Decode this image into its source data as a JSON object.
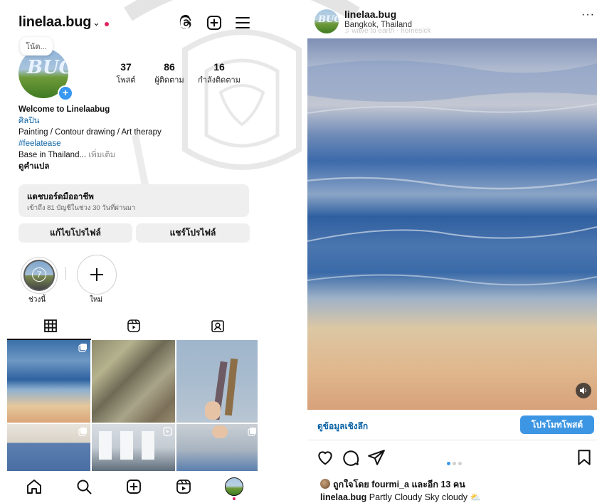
{
  "left": {
    "username": "linelaa.bug",
    "note": "โน้ต...",
    "avatar_text": "BUG",
    "stats": [
      {
        "value": "37",
        "label": "โพสต์"
      },
      {
        "value": "86",
        "label": "ผู้ติดตาม"
      },
      {
        "value": "16",
        "label": "กำลังติดตาม"
      }
    ],
    "bio": {
      "name": "Welcome to Linelaabug",
      "category": "ศิลปิน",
      "line1": "Painting / Contour drawing / Art therapy",
      "hashtag": "#feelatease",
      "line3": "Base in Thailand...",
      "more": "เพิ่มเติม",
      "translate": "ดูคำแปล"
    },
    "dashboard": {
      "title": "แดชบอร์ดมืออาชีพ",
      "subtitle": "เข้าถึง 81 บัญชีในช่วง 30 วันที่ผ่านมา"
    },
    "buttons": {
      "edit": "แก้ไขโปรไฟล์",
      "share": "แชร์โปรไฟล์"
    },
    "highlights": [
      {
        "label": "ช่วงนี้",
        "badge": "7"
      },
      {
        "label": "ใหม่"
      }
    ]
  },
  "right": {
    "username": "linelaa.bug",
    "location": "Bangkok, Thailand",
    "music": "♫ wave to earth · homesick",
    "insights_link": "ดูข้อมูลเชิงลึก",
    "promote_button": "โปรโมทโพสต์",
    "carousel": {
      "current": 1,
      "total": 3
    },
    "liked_by_prefix": "ถูกใจโดย ",
    "liked_by_user": "fourmi_a",
    "liked_by_suffix": " และอีก 13 คน",
    "caption_user": "linelaa.bug",
    "caption_text": " Partly Cloudy Sky cloudy ⛅"
  },
  "colors": {
    "accent": "#3897f0",
    "link": "#0b63a6",
    "notification": "#e0245e"
  },
  "icons": [
    "threads-icon",
    "new-post-icon",
    "menu-icon",
    "grid-icon",
    "reels-icon",
    "tagged-icon",
    "home-icon",
    "search-icon",
    "create-icon",
    "reels-nav-icon",
    "profile-icon",
    "more-icon",
    "sound-icon",
    "heart-icon",
    "comment-icon",
    "share-icon",
    "bookmark-icon",
    "multi-photo-icon"
  ]
}
